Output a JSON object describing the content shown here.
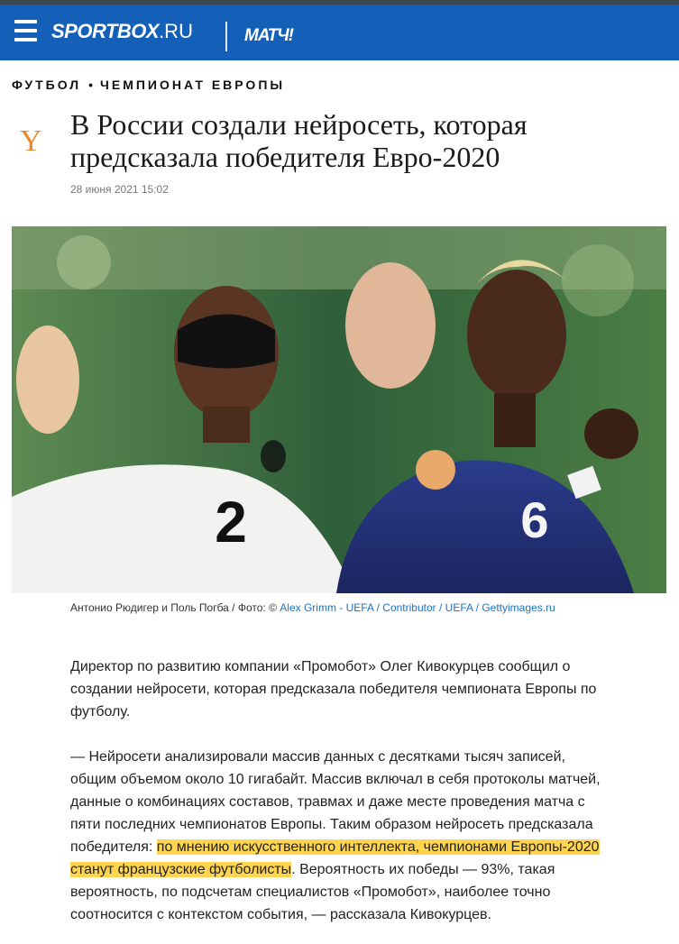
{
  "header": {
    "logo_main": "SPORTBOX",
    "logo_suffix": ".RU",
    "logo_match": "МАТЧ!"
  },
  "breadcrumb": {
    "items": [
      "ФУТБОЛ",
      "ЧЕМПИОНАТ ЕВРОПЫ"
    ],
    "separator": "•"
  },
  "article": {
    "author_logo": "Y",
    "title": "В России создали нейросеть, которая предсказала победителя Евро-2020",
    "date": "28 июня 2021 15:02",
    "photo": {
      "alt": "Антонио Рюдигер и Поль Погба",
      "left_jersey_number": "2",
      "right_jersey_number": "6",
      "caption_prefix": "Антонио Рюдигер и Поль Погба / Фото: ©",
      "caption_link": "Alex Grimm - UEFA / Contributor / UEFA / Gettyimages.ru"
    },
    "paragraphs": [
      "Директор по развитию компании «Промобот» Олег Кивокурцев сообщил о создании нейросети, которая предсказала победителя чемпионата Европы по футболу.",
      {
        "before": "— Нейросети анализировали массив данных с десятками тысяч записей, общим объемом около 10 гигабайт. Массив включал в себя протоколы матчей, данные о комбинациях составов, травмах и даже месте проведения матча с пяти последних чемпионатов Европы. Таким образом нейросеть предсказала победителя: ",
        "highlight": "по мнению искусственного интеллекта, чемпионами Европы-2020 станут французские футболисты",
        "after": ". Вероятность их победы — 93%, такая вероятность, по подсчетам специалистов «Промобот», наиболее точно соотносится с контекстом события, — рассказала Кивокурцев."
      }
    ]
  },
  "colors": {
    "header_bg": "#1460b8",
    "top_strip": "#3d4650",
    "link": "#1a73c8",
    "highlight": "#ffd54f",
    "author_logo": "#e9892b"
  }
}
